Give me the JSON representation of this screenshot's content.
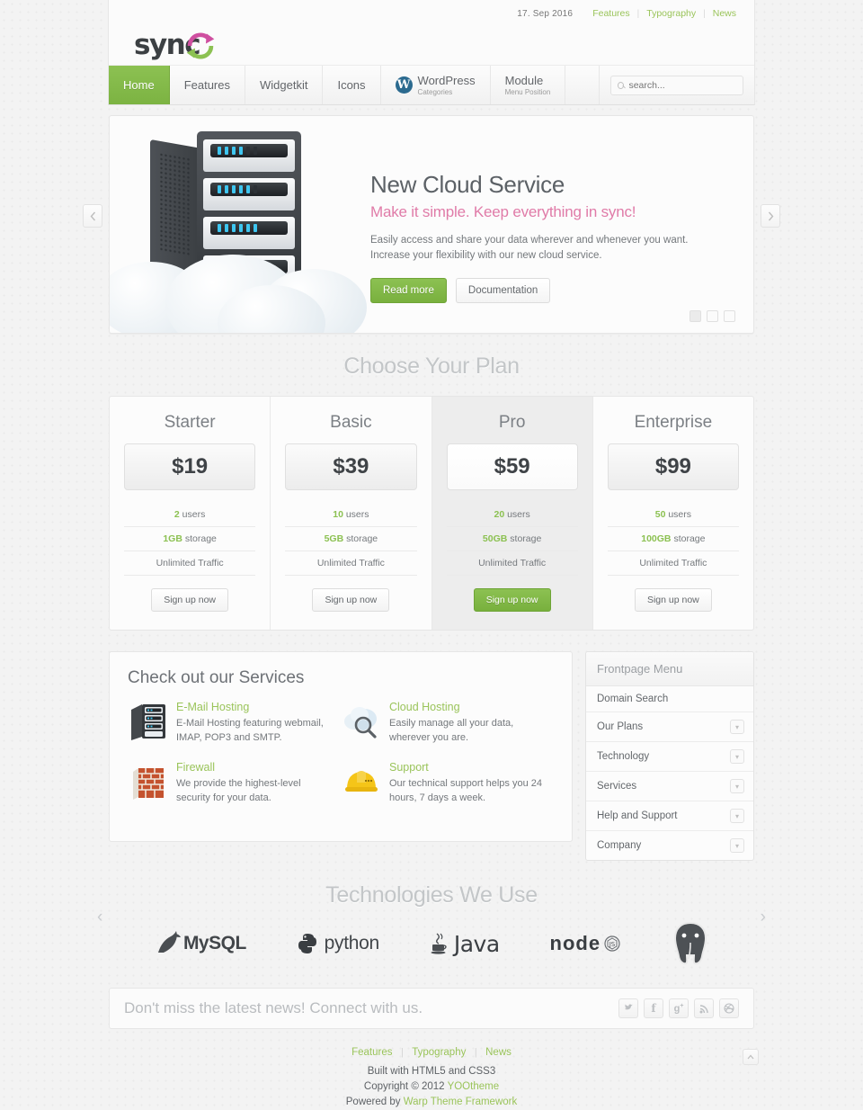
{
  "header": {
    "date": "17. Sep 2016",
    "toplinks": [
      "Features",
      "Typography",
      "News"
    ],
    "logo_text": "sync",
    "nav": [
      {
        "label": "Home",
        "sub": "",
        "icon": "",
        "active": true
      },
      {
        "label": "Features",
        "sub": "",
        "icon": "",
        "active": false
      },
      {
        "label": "Widgetkit",
        "sub": "",
        "icon": "",
        "active": false
      },
      {
        "label": "Icons",
        "sub": "",
        "icon": "",
        "active": false
      },
      {
        "label": "WordPress",
        "sub": "Categories",
        "icon": "wordpress-icon",
        "active": false
      },
      {
        "label": "Module",
        "sub": "Menu Position",
        "icon": "",
        "active": false
      }
    ],
    "search_placeholder": "search..."
  },
  "slideshow": {
    "title": "New Cloud Service",
    "subtitle": "Make it simple. Keep everything in sync!",
    "text": "Easily access and share your data wherever and whenever you want. Increase your flexibility with our new cloud service.",
    "primary_button": "Read more",
    "secondary_button": "Documentation",
    "prev_icon": "chevron-left-icon",
    "next_icon": "chevron-right-icon",
    "dots": 3,
    "active_dot": 0
  },
  "pricing": {
    "heading": "Choose Your Plan",
    "plans": [
      {
        "name": "Starter",
        "price": "$19",
        "users_value": "2",
        "users_label": " users",
        "storage_value": "1GB",
        "storage_label": " storage",
        "traffic": "Unlimited Traffic",
        "button": "Sign up now",
        "featured": false
      },
      {
        "name": "Basic",
        "price": "$39",
        "users_value": "10",
        "users_label": " users",
        "storage_value": "5GB",
        "storage_label": " storage",
        "traffic": "Unlimited Traffic",
        "button": "Sign up now",
        "featured": false
      },
      {
        "name": "Pro",
        "price": "$59",
        "users_value": "20",
        "users_label": " users",
        "storage_value": "50GB",
        "storage_label": " storage",
        "traffic": "Unlimited Traffic",
        "button": "Sign up now",
        "featured": true
      },
      {
        "name": "Enterprise",
        "price": "$99",
        "users_value": "50",
        "users_label": " users",
        "storage_value": "100GB",
        "storage_label": " storage",
        "traffic": "Unlimited Traffic",
        "button": "Sign up now",
        "featured": false
      }
    ]
  },
  "services": {
    "title": "Check out our Services",
    "items": [
      {
        "name": "E-Mail Hosting",
        "desc": "E-Mail Hosting featuring webmail, IMAP, POP3 and SMTP.",
        "icon": "server-rack-icon"
      },
      {
        "name": "Cloud Hosting",
        "desc": "Easily manage all your data, wherever you are.",
        "icon": "cloud-search-icon"
      },
      {
        "name": "Firewall",
        "desc": "We provide the highest-level security for your data.",
        "icon": "brick-wall-icon"
      },
      {
        "name": "Support",
        "desc": "Our technical support helps you 24 hours, 7 days a week.",
        "icon": "hard-hat-icon"
      }
    ]
  },
  "sidebar": {
    "title": "Frontpage Menu",
    "items": [
      {
        "label": "Domain Search",
        "has_chevron": false
      },
      {
        "label": "Our Plans",
        "has_chevron": true
      },
      {
        "label": "Technology",
        "has_chevron": true
      },
      {
        "label": "Services",
        "has_chevron": true
      },
      {
        "label": "Help and Support",
        "has_chevron": true
      },
      {
        "label": "Company",
        "has_chevron": true
      }
    ]
  },
  "technologies": {
    "heading": "Technologies We Use",
    "logos": [
      "MySQL",
      "python",
      "Java",
      "node",
      "PostgreSQL"
    ],
    "prev_icon": "chevron-left-icon",
    "next_icon": "chevron-right-icon"
  },
  "newsletter": {
    "text": "Don't miss the latest news! Connect with us.",
    "socials": [
      "twitter-icon",
      "facebook-icon",
      "google-plus-icon",
      "rss-icon",
      "dribbble-icon"
    ]
  },
  "footer": {
    "links": [
      "Features",
      "Typography",
      "News"
    ],
    "line1": "Built with HTML5 and CSS3",
    "copyright_prefix": "Copyright © 2012 ",
    "copyright_link": "YOOtheme",
    "powered_prefix": "Powered by ",
    "powered_link": "Warp Theme Framework",
    "totop_icon": "chevron-up-icon"
  },
  "colors": {
    "accent_green": "#8cc152",
    "accent_pink": "#e07ba8",
    "text_dark": "#5c6166",
    "muted": "#b9bcbf"
  }
}
